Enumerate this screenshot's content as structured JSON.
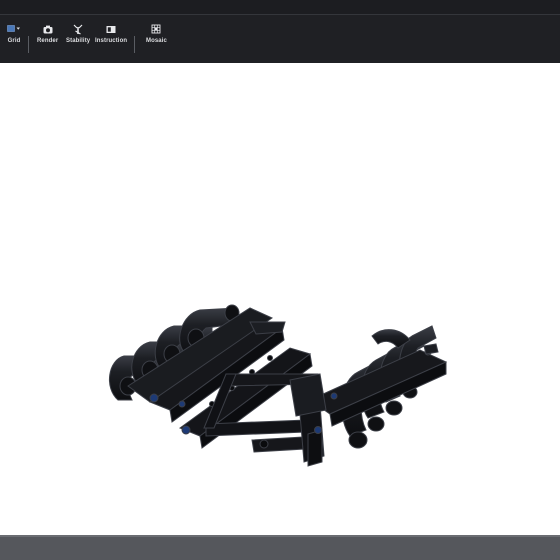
{
  "toolbar": {
    "tools": [
      {
        "icon": "grid-icon",
        "label": "Grid"
      },
      {
        "icon": "camera-icon",
        "label": "Render"
      },
      {
        "icon": "stability-icon",
        "label": "Stability"
      },
      {
        "icon": "instruction-icon",
        "label": "Instruction"
      },
      {
        "icon": "mosaic-icon",
        "label": "Mosaic"
      }
    ]
  },
  "viewport": {
    "model": "black-technic-manifold-frame",
    "background": "#ffffff"
  },
  "colors": {
    "toolbar_bg": "#1f2024",
    "part_black": "#17181b",
    "part_edge": "#3c3f47",
    "pin_blue": "#1d3a75",
    "grid_accent": "#4a78b8"
  }
}
